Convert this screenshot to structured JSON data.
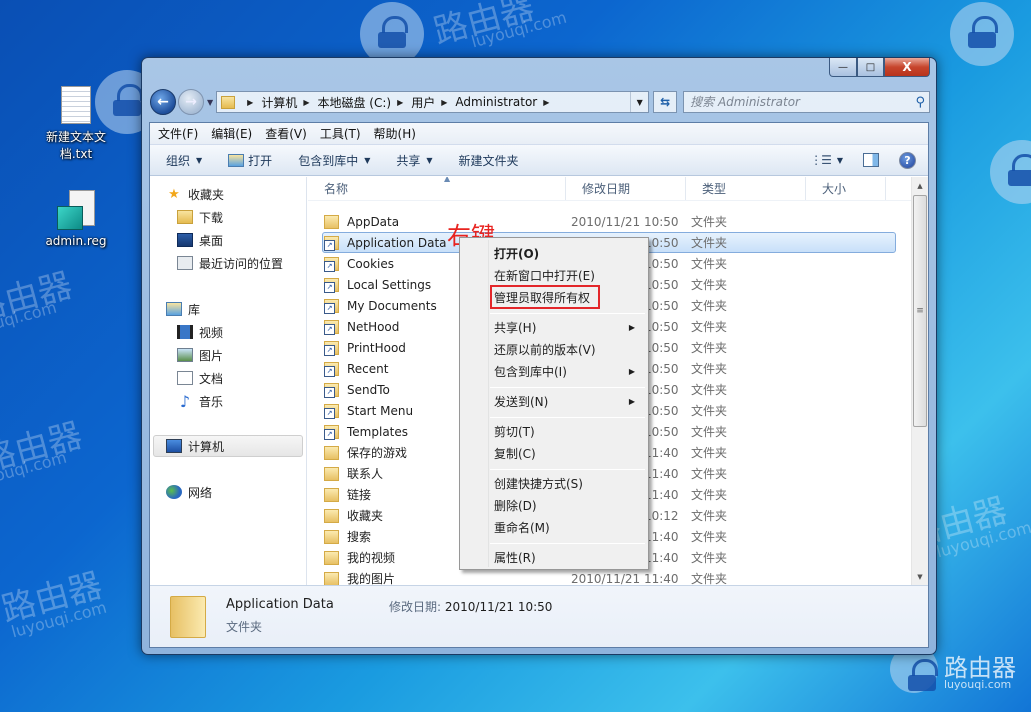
{
  "watermark": {
    "brand_cn": "路由器",
    "brand_url": "luyouqi.com"
  },
  "desktop": {
    "icons": [
      {
        "label": "新建文本文档.txt",
        "icon": "text-file-icon"
      },
      {
        "label": "admin.reg",
        "icon": "registry-file-icon"
      }
    ]
  },
  "window": {
    "caption_buttons": {
      "minimize": "—",
      "maximize": "□",
      "close": "X"
    },
    "address": {
      "crumbs": [
        "计算机",
        "本地磁盘 (C:)",
        "用户",
        "Administrator"
      ]
    },
    "search": {
      "placeholder": "搜索 Administrator"
    },
    "menubar": [
      "文件(F)",
      "编辑(E)",
      "查看(V)",
      "工具(T)",
      "帮助(H)"
    ],
    "toolbar": {
      "organize": "组织",
      "open": "打开",
      "include_in_library": "包含到库中",
      "share": "共享",
      "new_folder": "新建文件夹"
    },
    "navpane": {
      "favorites": "收藏夹",
      "favorites_items": [
        "下载",
        "桌面",
        "最近访问的位置"
      ],
      "libraries": "库",
      "libraries_items": [
        "视频",
        "图片",
        "文档",
        "音乐"
      ],
      "computer": "计算机",
      "network": "网络"
    },
    "columns": {
      "name": "名称",
      "modified": "修改日期",
      "type": "类型",
      "size": "大小"
    },
    "files": [
      {
        "name": "AppData",
        "modified": "2010/11/21 10:50",
        "type": "文件夹",
        "shortcut": false
      },
      {
        "name": "Application Data",
        "modified": "2010/11/21 10:50",
        "type": "文件夹",
        "shortcut": true,
        "selected": true
      },
      {
        "name": "Cookies",
        "modified": "2010/11/21 10:50",
        "type": "文件夹",
        "shortcut": true
      },
      {
        "name": "Local Settings",
        "modified": "2010/11/21 10:50",
        "type": "文件夹",
        "shortcut": true
      },
      {
        "name": "My Documents",
        "modified": "2010/11/21 10:50",
        "type": "文件夹",
        "shortcut": true
      },
      {
        "name": "NetHood",
        "modified": "2010/11/21 10:50",
        "type": "文件夹",
        "shortcut": true
      },
      {
        "name": "PrintHood",
        "modified": "2010/11/21 10:50",
        "type": "文件夹",
        "shortcut": true
      },
      {
        "name": "Recent",
        "modified": "2010/11/21 10:50",
        "type": "文件夹",
        "shortcut": true
      },
      {
        "name": "SendTo",
        "modified": "2010/11/21 10:50",
        "type": "文件夹",
        "shortcut": true
      },
      {
        "name": "Start Menu",
        "modified": "2010/11/21 10:50",
        "type": "文件夹",
        "shortcut": true
      },
      {
        "name": "Templates",
        "modified": "2010/11/21 10:50",
        "type": "文件夹",
        "shortcut": true
      },
      {
        "name": "保存的游戏",
        "modified": "2010/11/21 11:40",
        "type": "文件夹",
        "shortcut": false
      },
      {
        "name": "联系人",
        "modified": "2010/11/21 11:40",
        "type": "文件夹",
        "shortcut": false
      },
      {
        "name": "链接",
        "modified": "2010/11/21 11:40",
        "type": "文件夹",
        "shortcut": false
      },
      {
        "name": "收藏夹",
        "modified": "2010/11/21 10:12",
        "type": "文件夹",
        "shortcut": false
      },
      {
        "name": "搜索",
        "modified": "2010/11/21 11:40",
        "type": "文件夹",
        "shortcut": false
      },
      {
        "name": "我的视频",
        "modified": "2010/11/21 11:40",
        "type": "文件夹",
        "shortcut": false
      },
      {
        "name": "我的图片",
        "modified": "2010/11/21 11:40",
        "type": "文件夹",
        "shortcut": false
      }
    ],
    "details": {
      "name": "Application Data",
      "modified_label": "修改日期:",
      "modified": "2010/11/21 10:50",
      "type": "文件夹"
    }
  },
  "context_menu": {
    "items": [
      {
        "label": "打开(O)",
        "bold": true
      },
      {
        "label": "在新窗口中打开(E)"
      },
      {
        "label": "管理员取得所有权",
        "highlighted": true
      },
      {
        "label": "共享(H)",
        "submenu": true
      },
      {
        "label": "还原以前的版本(V)"
      },
      {
        "label": "包含到库中(I)",
        "submenu": true
      },
      {
        "label": "发送到(N)",
        "submenu": true
      },
      {
        "label": "剪切(T)"
      },
      {
        "label": "复制(C)"
      },
      {
        "label": "创建快捷方式(S)"
      },
      {
        "label": "删除(D)"
      },
      {
        "label": "重命名(M)"
      },
      {
        "label": "属性(R)"
      }
    ],
    "highlight_color": "#e3262a"
  },
  "annotation": {
    "text": "右键",
    "color": "#e8231f"
  }
}
